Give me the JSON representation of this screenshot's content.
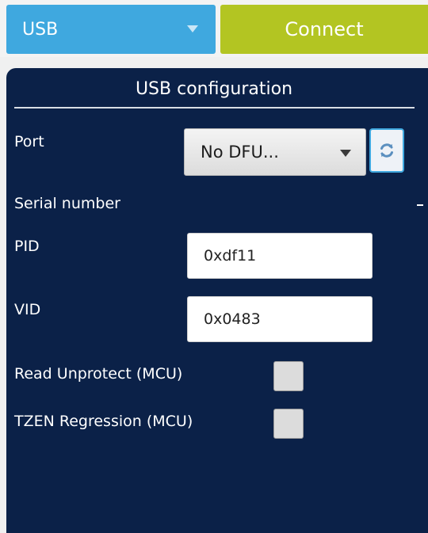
{
  "toolbar": {
    "interface_value": "USB",
    "connect_label": "Connect"
  },
  "config": {
    "title": "USB configuration",
    "port": {
      "label": "Port",
      "value": "No DFU..."
    },
    "serial_number": {
      "label": "Serial number",
      "value": "-"
    },
    "pid": {
      "label": "PID",
      "value": "0xdf11"
    },
    "vid": {
      "label": "VID",
      "value": "0x0483"
    },
    "read_unprotect": {
      "label": "Read Unprotect (MCU)",
      "checked": false
    },
    "tzen_regression": {
      "label": "TZEN Regression (MCU)",
      "checked": false
    }
  },
  "icons": {
    "interface_caret": "chevron-down-icon",
    "port_caret": "chevron-down-icon",
    "refresh": "refresh-icon"
  },
  "colors": {
    "interface_select": "#3fa8df",
    "connect_button": "#b3c522",
    "panel_background": "#0b2148"
  }
}
